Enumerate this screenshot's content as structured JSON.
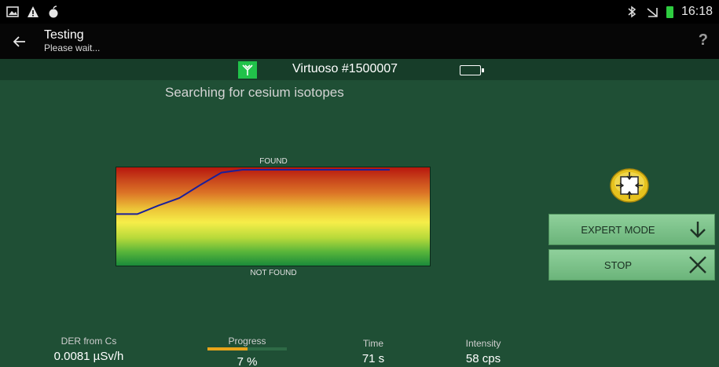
{
  "statusbar": {
    "time": "16:18",
    "left_icons": [
      "gallery-icon",
      "warning-icon",
      "apple-icon"
    ],
    "right_icons": [
      "bluetooth-icon",
      "signal-muted-icon",
      "battery-icon"
    ]
  },
  "actionbar": {
    "title": "Testing",
    "subtitle": "Please wait...",
    "help_label": "?"
  },
  "device": {
    "name": "Virtuoso #1500007"
  },
  "headline": "Searching for cesium isotopes",
  "gauge": {
    "top_label": "FOUND",
    "bottom_label": "NOT FOUND",
    "trace": [
      0.53,
      0.53,
      0.62,
      0.7,
      0.84,
      0.97,
      1.0,
      1.0,
      1.0,
      1.0,
      1.0,
      1.0,
      1.0,
      1.0
    ]
  },
  "buttons": {
    "expert_mode": "EXPERT MODE",
    "stop": "STOP"
  },
  "readouts": {
    "der_label": "DER from Cs",
    "der_value": "0.0081 µSv/h",
    "progress_label": "Progress",
    "progress_value": "7 %",
    "progress_fraction": 0.5,
    "time_label": "Time",
    "time_value": "71 s",
    "intensity_label": "Intensity",
    "intensity_value": "58 cps"
  },
  "colors": {
    "background": "#1f4f35",
    "button": "#7cc38a",
    "trace": "#1b1f9a",
    "progress": "#e8a41a"
  }
}
